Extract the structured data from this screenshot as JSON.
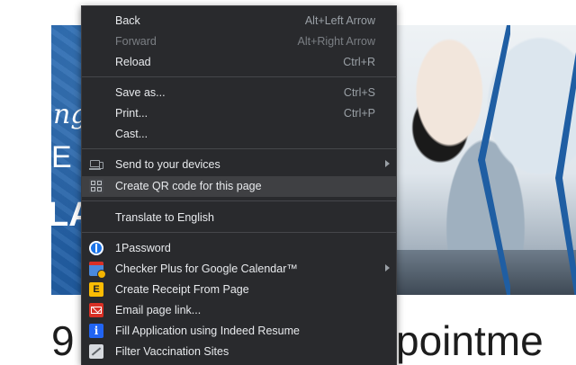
{
  "background": {
    "banner_glyphs": [
      "ng",
      "E",
      "LA"
    ],
    "heading_left": "9",
    "heading_right": "pointme"
  },
  "menu": {
    "items": [
      {
        "label": "Back",
        "shortcut": "Alt+Left Arrow"
      },
      {
        "label": "Forward",
        "shortcut": "Alt+Right Arrow",
        "disabled": true
      },
      {
        "label": "Reload",
        "shortcut": "Ctrl+R"
      },
      {
        "label": "Save as...",
        "shortcut": "Ctrl+S"
      },
      {
        "label": "Print...",
        "shortcut": "Ctrl+P"
      },
      {
        "label": "Cast..."
      },
      {
        "label": "Send to your devices",
        "icon": "devices-icon",
        "submenu": true
      },
      {
        "label": "Create QR code for this page",
        "icon": "qr-code-icon",
        "highlighted": true
      },
      {
        "label": "Translate to English"
      },
      {
        "label": "1Password",
        "icon": "1password-icon"
      },
      {
        "label": "Checker Plus for Google Calendar™",
        "icon": "calendar-extension-icon",
        "submenu": true
      },
      {
        "label": "Create Receipt From Page",
        "icon": "receipt-icon"
      },
      {
        "label": "Email page link...",
        "icon": "email-icon"
      },
      {
        "label": "Fill Application using Indeed Resume",
        "icon": "indeed-icon"
      },
      {
        "label": "Filter Vaccination Sites",
        "icon": "vaccination-icon"
      }
    ],
    "icon_text": {
      "receipt": "E",
      "indeed": "i"
    }
  },
  "colors": {
    "menu_bg": "#292a2d",
    "menu_highlight": "#3f4043",
    "menu_text": "#e8eaed",
    "shortcut_text": "#9aa0a6",
    "banner_blue": "#1f5ea3"
  }
}
